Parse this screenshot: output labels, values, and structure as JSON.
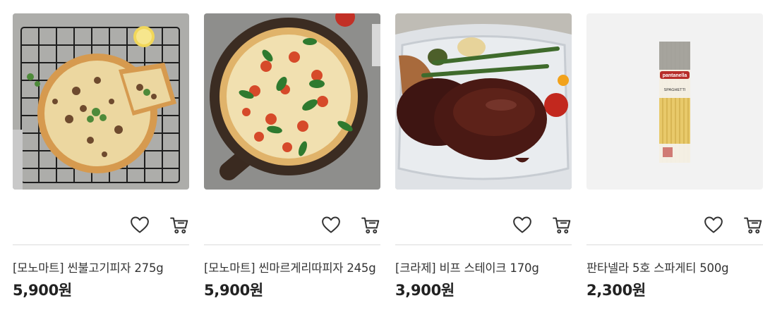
{
  "products": [
    {
      "name": "[모노마트] 씬불고기피자 275g",
      "price": "5,900원",
      "image": "bulgogi-pizza-photo"
    },
    {
      "name": "[모노마트] 씬마르게리따피자 245g",
      "price": "5,900원",
      "image": "margherita-pizza-photo"
    },
    {
      "name": "[크라제] 비프 스테이크 170g",
      "price": "3,900원",
      "image": "beef-steak-photo"
    },
    {
      "name": "판타넬라 5호 스파게티 500g",
      "price": "2,300원",
      "image": "spaghetti-package-photo"
    }
  ],
  "package_label": {
    "brand": "pantanella",
    "text": "SPAGHETTI"
  },
  "icons": {
    "wishlist": "heart-icon",
    "cart": "cart-icon"
  },
  "colors": {
    "text": "#222222",
    "divider": "#dcdcdc",
    "icon": "#333333"
  }
}
